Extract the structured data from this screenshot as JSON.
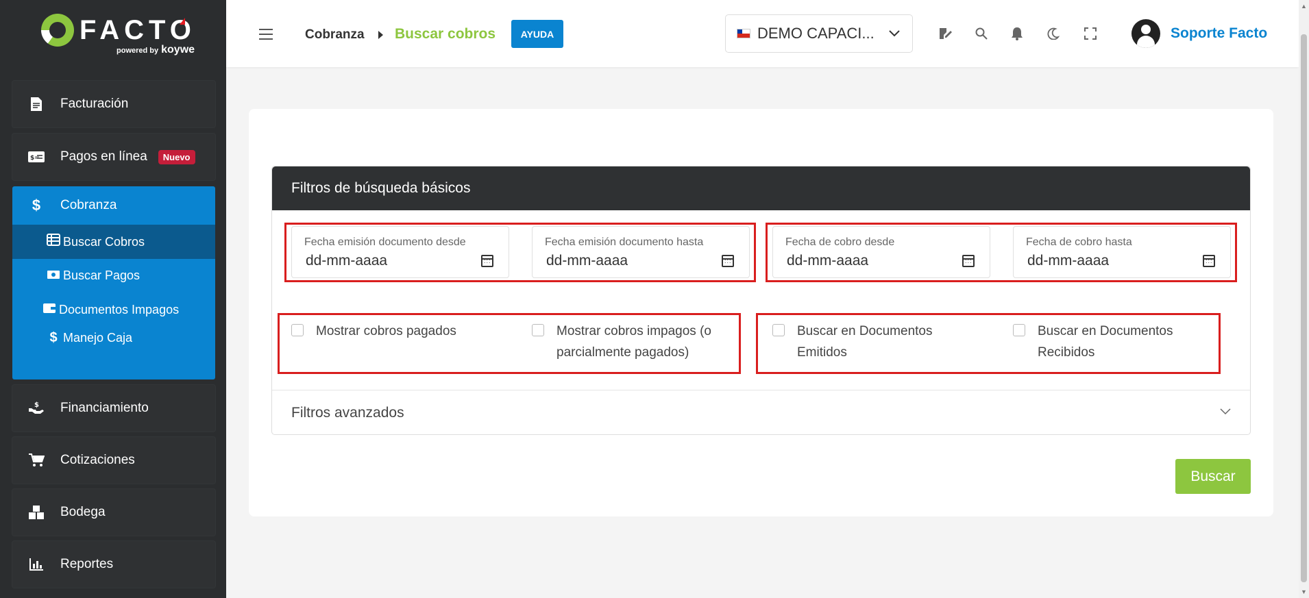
{
  "brand": {
    "name": "FACTO",
    "powered": "powered by",
    "company": "koywe"
  },
  "sidebar": {
    "items": [
      {
        "label": "Facturación",
        "icon": "file-icon"
      },
      {
        "label": "Pagos en línea",
        "icon": "money-card-icon",
        "badge": "Nuevo"
      },
      {
        "label": "Financiamiento",
        "icon": "hand-dollar-icon"
      },
      {
        "label": "Cotizaciones",
        "icon": "cart-icon"
      },
      {
        "label": "Bodega",
        "icon": "boxes-icon"
      },
      {
        "label": "Reportes",
        "icon": "chart-icon"
      }
    ],
    "cobranza": {
      "label": "Cobranza",
      "subitems": [
        {
          "label": "Buscar Cobros",
          "active": true
        },
        {
          "label": "Buscar Pagos"
        },
        {
          "label": "Documentos Impagos"
        },
        {
          "label": "Manejo Caja"
        }
      ]
    }
  },
  "header": {
    "breadcrumb_root": "Cobranza",
    "breadcrumb_current": "Buscar cobros",
    "help_label": "AYUDA",
    "company": "DEMO CAPACI...",
    "user": "Soporte Facto"
  },
  "filters": {
    "title": "Filtros de búsqueda básicos",
    "dates": [
      {
        "label": "Fecha emisión documento desde",
        "placeholder": "dd-mm-aaaa"
      },
      {
        "label": "Fecha emisión documento hasta",
        "placeholder": "dd-mm-aaaa"
      },
      {
        "label": "Fecha de cobro desde",
        "placeholder": "dd-mm-aaaa"
      },
      {
        "label": "Fecha de cobro hasta",
        "placeholder": "dd-mm-aaaa"
      }
    ],
    "checks": [
      {
        "label": "Mostrar cobros pagados"
      },
      {
        "label": "Mostrar cobros impagos (o parcialmente pagados)"
      },
      {
        "label": "Buscar en Documentos Emitidos"
      },
      {
        "label": "Buscar en Documentos Recibidos"
      }
    ],
    "advanced_label": "Filtros avanzados",
    "search_label": "Buscar"
  },
  "colors": {
    "accent_blue": "#0a84d0",
    "accent_green": "#8dc63f",
    "highlight_red": "#d91e1e",
    "sidebar_bg": "#2b2d2f"
  }
}
